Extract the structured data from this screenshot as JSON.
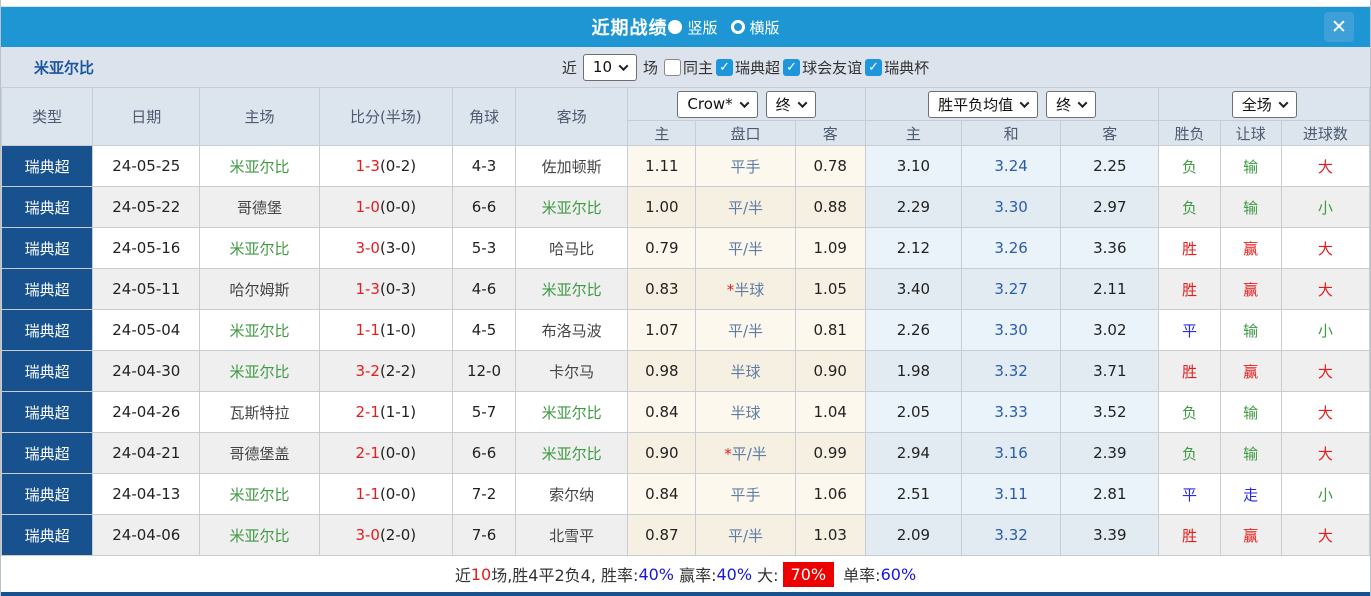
{
  "colors": {
    "accent_blue": "#1e96d3",
    "navy": "#17518e",
    "result_red": "#e51c1c",
    "result_green": "#3f9a43",
    "result_blue": "#2929e0",
    "draw_odds_blue": "#2b5cac",
    "handicap_steel": "#5e7ca4",
    "handicap_bg": "#fdf8ed",
    "odds_bg": "#e9f3f9",
    "badge_red": "#ee0000"
  },
  "icons": {
    "close": "✕",
    "check": "✓"
  },
  "titlebar": {
    "title": "近期战绩",
    "layout_options": [
      {
        "label": "竖版",
        "selected": true
      },
      {
        "label": "横版",
        "selected": false
      }
    ]
  },
  "filterbar": {
    "team": "米亚尔比",
    "recent_label": "近",
    "recent_value": "10",
    "unit_label": "场",
    "checkboxes": [
      {
        "label": "同主",
        "checked": false
      },
      {
        "label": "瑞典超",
        "checked": true
      },
      {
        "label": "球会友谊",
        "checked": true
      },
      {
        "label": "瑞典杯",
        "checked": true
      }
    ]
  },
  "table": {
    "base_headers": [
      "类型",
      "日期",
      "主场",
      "比分(半场)",
      "角球",
      "客场"
    ],
    "handicap_group": {
      "book_select": "Crow*",
      "time_select": "终",
      "cols": [
        "主",
        "盘口",
        "客"
      ]
    },
    "odds_group": {
      "type_select": "胜平负均值",
      "time_select": "终",
      "cols": [
        "主",
        "和",
        "客"
      ]
    },
    "result_group": {
      "scope_select": "全场",
      "cols": [
        "胜负",
        "让球",
        "进球数"
      ]
    },
    "rows": [
      {
        "type": "瑞典超",
        "date": "24-05-25",
        "home": "米亚尔比",
        "score_ft": "1-3",
        "score_ht": "(0-2)",
        "corners": "4-3",
        "away": "佐加顿斯",
        "h_home": "1.11",
        "handicap": "平手",
        "handicap_star": false,
        "h_away": "0.78",
        "o_home": "3.10",
        "o_draw": "3.24",
        "o_away": "2.25",
        "r_wdl": "负",
        "r_handicap": "输",
        "r_goals": "大"
      },
      {
        "type": "瑞典超",
        "date": "24-05-22",
        "home": "哥德堡",
        "score_ft": "1-0",
        "score_ht": "(0-0)",
        "corners": "6-6",
        "away": "米亚尔比",
        "h_home": "1.00",
        "handicap": "平/半",
        "handicap_star": false,
        "h_away": "0.88",
        "o_home": "2.29",
        "o_draw": "3.30",
        "o_away": "2.97",
        "r_wdl": "负",
        "r_handicap": "输",
        "r_goals": "小"
      },
      {
        "type": "瑞典超",
        "date": "24-05-16",
        "home": "米亚尔比",
        "score_ft": "3-0",
        "score_ht": "(3-0)",
        "corners": "5-3",
        "away": "哈马比",
        "h_home": "0.79",
        "handicap": "平/半",
        "handicap_star": false,
        "h_away": "1.09",
        "o_home": "2.12",
        "o_draw": "3.26",
        "o_away": "3.36",
        "r_wdl": "胜",
        "r_handicap": "赢",
        "r_goals": "大"
      },
      {
        "type": "瑞典超",
        "date": "24-05-11",
        "home": "哈尔姆斯",
        "score_ft": "1-3",
        "score_ht": "(0-3)",
        "corners": "4-6",
        "away": "米亚尔比",
        "h_home": "0.83",
        "handicap": "半球",
        "handicap_star": true,
        "h_away": "1.05",
        "o_home": "3.40",
        "o_draw": "3.27",
        "o_away": "2.11",
        "r_wdl": "胜",
        "r_handicap": "赢",
        "r_goals": "大"
      },
      {
        "type": "瑞典超",
        "date": "24-05-04",
        "home": "米亚尔比",
        "score_ft": "1-1",
        "score_ht": "(1-0)",
        "corners": "4-5",
        "away": "布洛马波",
        "h_home": "1.07",
        "handicap": "平/半",
        "handicap_star": false,
        "h_away": "0.81",
        "o_home": "2.26",
        "o_draw": "3.30",
        "o_away": "3.02",
        "r_wdl": "平",
        "r_handicap": "输",
        "r_goals": "小"
      },
      {
        "type": "瑞典超",
        "date": "24-04-30",
        "home": "米亚尔比",
        "score_ft": "3-2",
        "score_ht": "(2-2)",
        "corners": "12-0",
        "away": "卡尔马",
        "h_home": "0.98",
        "handicap": "半球",
        "handicap_star": false,
        "h_away": "0.90",
        "o_home": "1.98",
        "o_draw": "3.32",
        "o_away": "3.71",
        "r_wdl": "胜",
        "r_handicap": "赢",
        "r_goals": "大"
      },
      {
        "type": "瑞典超",
        "date": "24-04-26",
        "home": "瓦斯特拉",
        "score_ft": "2-1",
        "score_ht": "(1-1)",
        "corners": "5-7",
        "away": "米亚尔比",
        "h_home": "0.84",
        "handicap": "半球",
        "handicap_star": false,
        "h_away": "1.04",
        "o_home": "2.05",
        "o_draw": "3.33",
        "o_away": "3.52",
        "r_wdl": "负",
        "r_handicap": "输",
        "r_goals": "大"
      },
      {
        "type": "瑞典超",
        "date": "24-04-21",
        "home": "哥德堡盖",
        "score_ft": "2-1",
        "score_ht": "(0-0)",
        "corners": "6-6",
        "away": "米亚尔比",
        "h_home": "0.90",
        "handicap": "平/半",
        "handicap_star": true,
        "h_away": "0.99",
        "o_home": "2.94",
        "o_draw": "3.16",
        "o_away": "2.39",
        "r_wdl": "负",
        "r_handicap": "输",
        "r_goals": "大"
      },
      {
        "type": "瑞典超",
        "date": "24-04-13",
        "home": "米亚尔比",
        "score_ft": "1-1",
        "score_ht": "(0-0)",
        "corners": "7-2",
        "away": "索尔纳",
        "h_home": "0.84",
        "handicap": "平手",
        "handicap_star": false,
        "h_away": "1.06",
        "o_home": "2.51",
        "o_draw": "3.11",
        "o_away": "2.81",
        "r_wdl": "平",
        "r_handicap": "走",
        "r_goals": "小"
      },
      {
        "type": "瑞典超",
        "date": "24-04-06",
        "home": "米亚尔比",
        "score_ft": "3-0",
        "score_ht": "(2-0)",
        "corners": "7-6",
        "away": "北雪平",
        "h_home": "0.87",
        "handicap": "平/半",
        "handicap_star": false,
        "h_away": "1.03",
        "o_home": "2.09",
        "o_draw": "3.32",
        "o_away": "3.39",
        "r_wdl": "胜",
        "r_handicap": "赢",
        "r_goals": "大"
      }
    ]
  },
  "value_colors": {
    "胜": "red",
    "平": "blue",
    "负": "green",
    "赢": "red",
    "走": "blue",
    "输": "green",
    "大": "red",
    "小": "green"
  },
  "summary": {
    "segments": [
      {
        "text": "近",
        "style": "plain"
      },
      {
        "text": "10",
        "style": "red"
      },
      {
        "text": "场,胜4平2负4, ",
        "style": "plain"
      },
      {
        "text": "胜率:",
        "style": "plain"
      },
      {
        "text": "40%",
        "style": "blue"
      },
      {
        "text": " 赢率:",
        "style": "plain"
      },
      {
        "text": "40%",
        "style": "blue"
      },
      {
        "text": " 大:",
        "style": "plain"
      },
      {
        "text": "70%",
        "style": "badge"
      },
      {
        "text": " 单率:",
        "style": "plain"
      },
      {
        "text": "60%",
        "style": "blue"
      }
    ]
  }
}
